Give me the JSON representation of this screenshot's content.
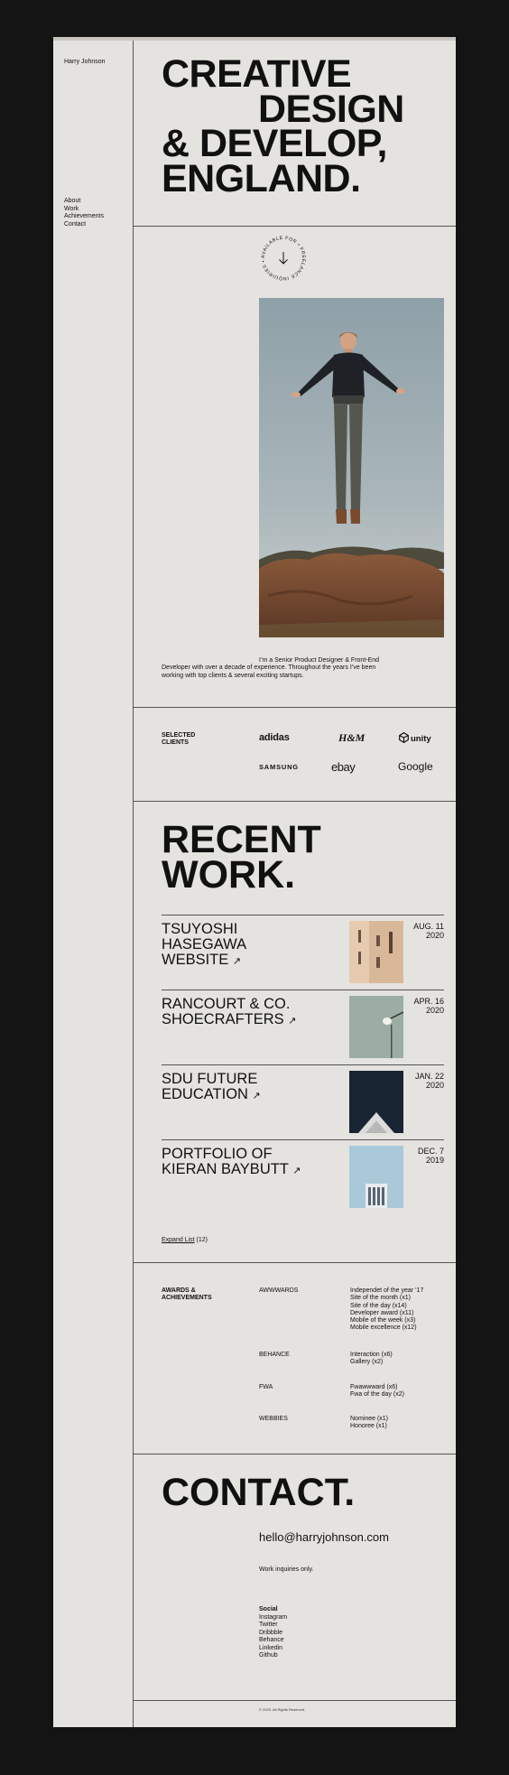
{
  "sidebar": {
    "name": "Harry Johnson",
    "nav": [
      "About",
      "Work",
      "Achievements",
      "Contact"
    ]
  },
  "hero": {
    "lines": [
      "CREATIVE",
      "DESIGN",
      "& DEVELOP,",
      "ENGLAND."
    ]
  },
  "about": {
    "badge_text": "AVAILABLE FOR • FREELANCE INQUIRIES •",
    "intro": "I’m a Senior Product Designer & Front-End Developer with over a decade of experience. Throughout the years I’ve been working with top clients & several exciting startups."
  },
  "clients": {
    "label": "SELECTED CLIENTS",
    "logos": [
      "adidas",
      "H&M",
      "unity",
      "SAMSUNG",
      "ebay",
      "Google"
    ]
  },
  "recent_work": {
    "title_lines": [
      "RECENT",
      "WORK."
    ],
    "items": [
      {
        "title": "TSUYOSHI HASEGAWA WEBSITE",
        "date_1": "AUG. 11",
        "date_2": "2020"
      },
      {
        "title": "RANCOURT & CO. SHOECRAFTERS",
        "date_1": "APR. 16",
        "date_2": "2020"
      },
      {
        "title": "SDU FUTURE EDUCATION",
        "date_1": "JAN. 22",
        "date_2": "2020"
      },
      {
        "title": "PORTFOLIO OF KIERAN BAYBUTT",
        "date_1": "DEC. 7",
        "date_2": "2019"
      }
    ],
    "expand_label": "Expand List",
    "expand_count": "(12)"
  },
  "awards": {
    "label": "AWARDS & ACHIEVEMENTS",
    "groups": [
      {
        "org": "AWWWARDS",
        "items": [
          "Independet of the year ’17",
          "Site of the month (x1)",
          "Site of the day (x14)",
          "Developer award (x11)",
          "Mobile of the week (x3)",
          "Mobile excellence (x12)"
        ]
      },
      {
        "org": "BEHANCE",
        "items": [
          "Interaction (x6)",
          "Gallery (x2)"
        ]
      },
      {
        "org": "FWA",
        "items": [
          "Fwawwward (x6)",
          "Fwa of the day (x2)"
        ]
      },
      {
        "org": "WEBBIES",
        "items": [
          "Nominee (x1)",
          "Honoree (x1)"
        ]
      }
    ]
  },
  "contact": {
    "title": "CONTACT.",
    "email": "hello@harryjohnson.com",
    "inquiries": "Work inquiries only.",
    "social_title": "Social",
    "social": [
      "Instagram",
      "Twitter",
      "Dribbble",
      "Behance",
      "Linkedin",
      "Github"
    ]
  },
  "footer": {
    "copyright": "© 2020. All Rights Reserved."
  }
}
